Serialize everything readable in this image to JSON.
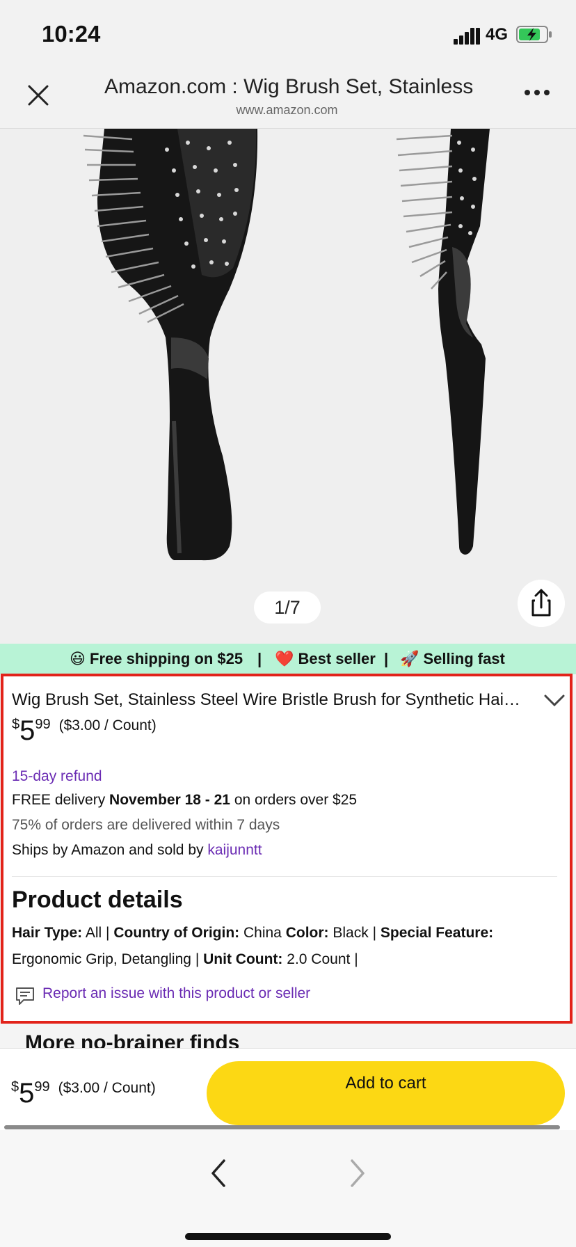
{
  "status_bar": {
    "time": "10:24",
    "network": "4G"
  },
  "browser": {
    "title": "Amazon.com : Wig Brush Set, Stainless Steel Wire Bristle Brush for Synthetic Hair",
    "url": "www.amazon.com"
  },
  "gallery": {
    "counter": "1/7"
  },
  "promo": {
    "items": [
      "😃 Free shipping on $25",
      "❤️ Best seller",
      "🚀 Selling fast"
    ],
    "separator": "|"
  },
  "product": {
    "title": "Wig Brush Set, Stainless Steel Wire Bristle Brush for Synthetic Hai…",
    "price": {
      "currency": "$",
      "whole": "5",
      "fraction": "99",
      "unit_price": "($3.00 / Count)"
    },
    "refund": "15-day refund",
    "delivery": {
      "prefix": "FREE delivery",
      "dates": "November 18 - 21",
      "suffix": "on orders over $25"
    },
    "delivery_stat": "75% of orders are delivered within 7 days",
    "ships": {
      "text": "Ships by Amazon and sold by",
      "seller": "kaijunntt"
    }
  },
  "details": {
    "heading": "Product details",
    "hair_type": {
      "label": "Hair Type:",
      "value": "All"
    },
    "country": {
      "label": "Country of Origin:",
      "value": "China"
    },
    "color": {
      "label": "Color:",
      "value": "Black"
    },
    "feature": {
      "label": "Special Feature:",
      "value": "Ergonomic Grip, Detangling"
    },
    "unit_count": {
      "label": "Unit Count:",
      "value": "2.0 Count"
    },
    "separator": "|",
    "report_link": "Report an issue with this product or seller"
  },
  "more_finds": "More no-brainer finds",
  "cart_bar": {
    "price": {
      "currency": "$",
      "whole": "5",
      "fraction": "99",
      "unit_price": "($3.00 / Count)"
    },
    "add_to_cart": "Add to cart"
  },
  "colors": {
    "accent_purple": "#6a2bb3",
    "cart_yellow": "#fcd814",
    "promo_green": "#b8f3d6",
    "highlight_red": "#e2231a"
  }
}
